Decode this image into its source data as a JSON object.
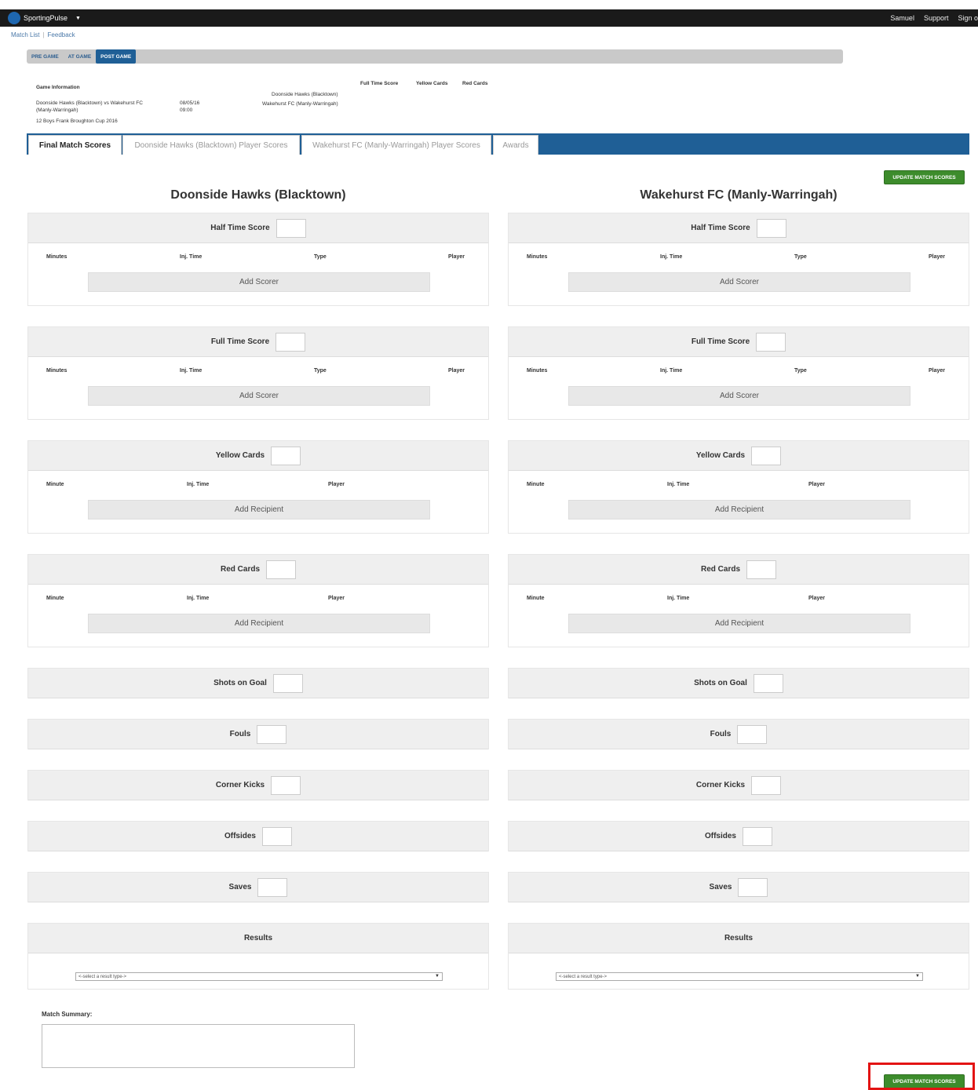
{
  "topbar": {
    "brand": "SportingPulse",
    "links": [
      "Samuel",
      "Support",
      "Sign o"
    ]
  },
  "subnav": [
    "Match List",
    "Feedback"
  ],
  "stages": [
    "PRE GAME",
    "AT GAME",
    "POST GAME"
  ],
  "game_info": {
    "heading": "Game Information",
    "match_line1": "Doonside Hawks (Blacktown) vs Wakehurst FC",
    "match_line2": "(Manly-Warringah)",
    "date": "08/05/16",
    "time": "09:00",
    "competition": "12 Boys Frank Broughton Cup 2016",
    "team1": "Doonside Hawks (Blacktown)",
    "team2": "Wakehurst FC (Manly-Warringah)",
    "headers": [
      "Full Time Score",
      "Yellow Cards",
      "Red Cards"
    ]
  },
  "tabs": [
    "Final Match Scores",
    "Doonside Hawks (Blacktown) Player Scores",
    "Wakehurst FC (Manly-Warringah) Player Scores",
    "Awards"
  ],
  "update_label": "UPDATE MATCH SCORES",
  "teams": [
    {
      "name": "Doonside Hawks (Blacktown)",
      "half_time": "Half Time Score",
      "full_time": "Full Time Score",
      "yellow": "Yellow Cards",
      "red": "Red Cards",
      "shots": "Shots on Goal",
      "fouls": "Fouls",
      "corners": "Corner Kicks",
      "offsides": "Offsides",
      "saves": "Saves",
      "results": "Results",
      "select_placeholder": "<-select a result type->"
    },
    {
      "name": "Wakehurst FC (Manly-Warringah)",
      "half_time": "Half Time Score",
      "full_time": "Full Time Score",
      "yellow": "Yellow Cards",
      "red": "Red Cards",
      "shots": "Shots on Goal",
      "fouls": "Fouls",
      "corners": "Corner Kicks",
      "offsides": "Offsides",
      "saves": "Saves",
      "results": "Results",
      "select_placeholder": "<-select a result type->"
    }
  ],
  "score_columns": [
    "Minutes",
    "Inj. Time",
    "Type",
    "Player"
  ],
  "card_columns": [
    "Minute",
    "Inj. Time",
    "Player"
  ],
  "add_scorer": "Add Scorer",
  "add_recipient": "Add Recipient",
  "summary_label": "Match Summary:"
}
